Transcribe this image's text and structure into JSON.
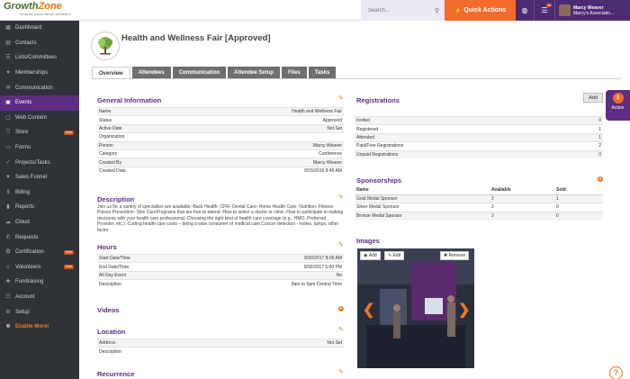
{
  "brand": {
    "name_a": "Growth",
    "name_b": "Zone",
    "tagline": "smarter association software"
  },
  "sidebar": {
    "items": [
      {
        "label": "Dashboard",
        "icon": "▦"
      },
      {
        "label": "Contacts",
        "icon": "▤"
      },
      {
        "label": "Lists/Committees",
        "icon": "☰"
      },
      {
        "label": "Memberships",
        "icon": "♥"
      },
      {
        "label": "Communication",
        "icon": "✉"
      },
      {
        "label": "Events",
        "icon": "▣"
      },
      {
        "label": "Web Content",
        "icon": "▢"
      },
      {
        "label": "Store",
        "icon": "⛉",
        "badge": "beta"
      },
      {
        "label": "Forms",
        "icon": "▭"
      },
      {
        "label": "Projects/Tasks",
        "icon": "✓"
      },
      {
        "label": "Sales Funnel",
        "icon": "▼"
      },
      {
        "label": "Billing",
        "icon": "$"
      },
      {
        "label": "Reports",
        "icon": "▮"
      },
      {
        "label": "Cloud",
        "icon": "☁"
      },
      {
        "label": "Requests",
        "icon": "✆"
      },
      {
        "label": "Certification",
        "icon": "✪",
        "badge": "beta"
      },
      {
        "label": "Volunteers",
        "icon": "☺",
        "badge": "beta"
      },
      {
        "label": "Fundraising",
        "icon": "✚"
      },
      {
        "label": "Account",
        "icon": "☷"
      },
      {
        "label": "Setup",
        "icon": "⚙"
      },
      {
        "label": "Enable More!",
        "icon": "✱"
      }
    ]
  },
  "topbar": {
    "search_placeholder": "Search...",
    "quick_actions": "Quick Actions",
    "inbox_badge": "99",
    "user_name": "Marcy Weaver",
    "user_org": "Marcy's Associatio..."
  },
  "page": {
    "title": "Health and Wellness Fair [Approved]",
    "tabs": [
      "Overview",
      "Attendees",
      "Communication",
      "Attendee Setup",
      "Files",
      "Tasks"
    ]
  },
  "general": {
    "heading": "General Information",
    "rows": [
      {
        "k": "Name",
        "v": "Health and Wellness Fair"
      },
      {
        "k": "Status",
        "v": "Approved"
      },
      {
        "k": "Active Date",
        "v": "Not Set"
      },
      {
        "k": "Organization",
        "v": ""
      },
      {
        "k": "Person",
        "v": "Marcy Weaver"
      },
      {
        "k": "Category",
        "v": "Conference"
      },
      {
        "k": "Created By",
        "v": "Marcy Weaver"
      },
      {
        "k": "Created Date",
        "v": "9/15/2016 8:46 AM"
      }
    ]
  },
  "description": {
    "heading": "Description",
    "text": "Join us for a variety of specialties are available:-Back Health- CPR- Dental Care- Home Health Care- Nutrition- Fitness- Poison Prevention- Skin CarePrograms that are free to attend:-How to select a doctor or clinic.-How to participate in making decisions with your health care professional.-Choosing the right kind of health care coverage (e.g., HMO, Preferred Provider, etc.).-Cutting health care costs – being a wise consumer of medical care.Cancer detection - moles, lumps, other factor"
  },
  "hours": {
    "heading": "Hours",
    "rows": [
      {
        "k": "Start Date/Time",
        "v": "9/30/2017 8:00 AM"
      },
      {
        "k": "End Date/Time",
        "v": "9/30/2017 5:00 PM"
      },
      {
        "k": "All Day Event",
        "v": "No"
      },
      {
        "k": "Description",
        "v": "8am to 5pm Central Time"
      }
    ]
  },
  "videos": {
    "heading": "Videos"
  },
  "location": {
    "heading": "Location",
    "rows": [
      {
        "k": "Address",
        "v": "Not Set"
      },
      {
        "k": "Description",
        "v": ""
      }
    ]
  },
  "recurrence": {
    "heading": "Recurrence"
  },
  "registrations": {
    "heading": "Registrations",
    "add_label": "Add",
    "rows": [
      {
        "k": "Invited",
        "v": "0"
      },
      {
        "k": "Registered",
        "v": "1"
      },
      {
        "k": "Attended",
        "v": "1"
      },
      {
        "k": "Paid/Free Registrations",
        "v": "2"
      },
      {
        "k": "Unpaid Registrations",
        "v": "0"
      }
    ]
  },
  "action_tab": {
    "count": "1",
    "label": "Action"
  },
  "sponsorships": {
    "heading": "Sponsorships",
    "columns": [
      "Name",
      "Available",
      "Sold"
    ],
    "rows": [
      [
        "Gold Medal Sponsor",
        "2",
        "1"
      ],
      [
        "Silver Medal Sponsor",
        "2",
        "0"
      ],
      [
        "Bronze Medal Sponsor",
        "2",
        "0"
      ]
    ]
  },
  "images": {
    "heading": "Images",
    "add": "Add",
    "edit": "Edit",
    "remove": "Remove"
  },
  "help": "?",
  "colors": {
    "accent": "#5c2d82",
    "orange": "#f26b2b"
  }
}
